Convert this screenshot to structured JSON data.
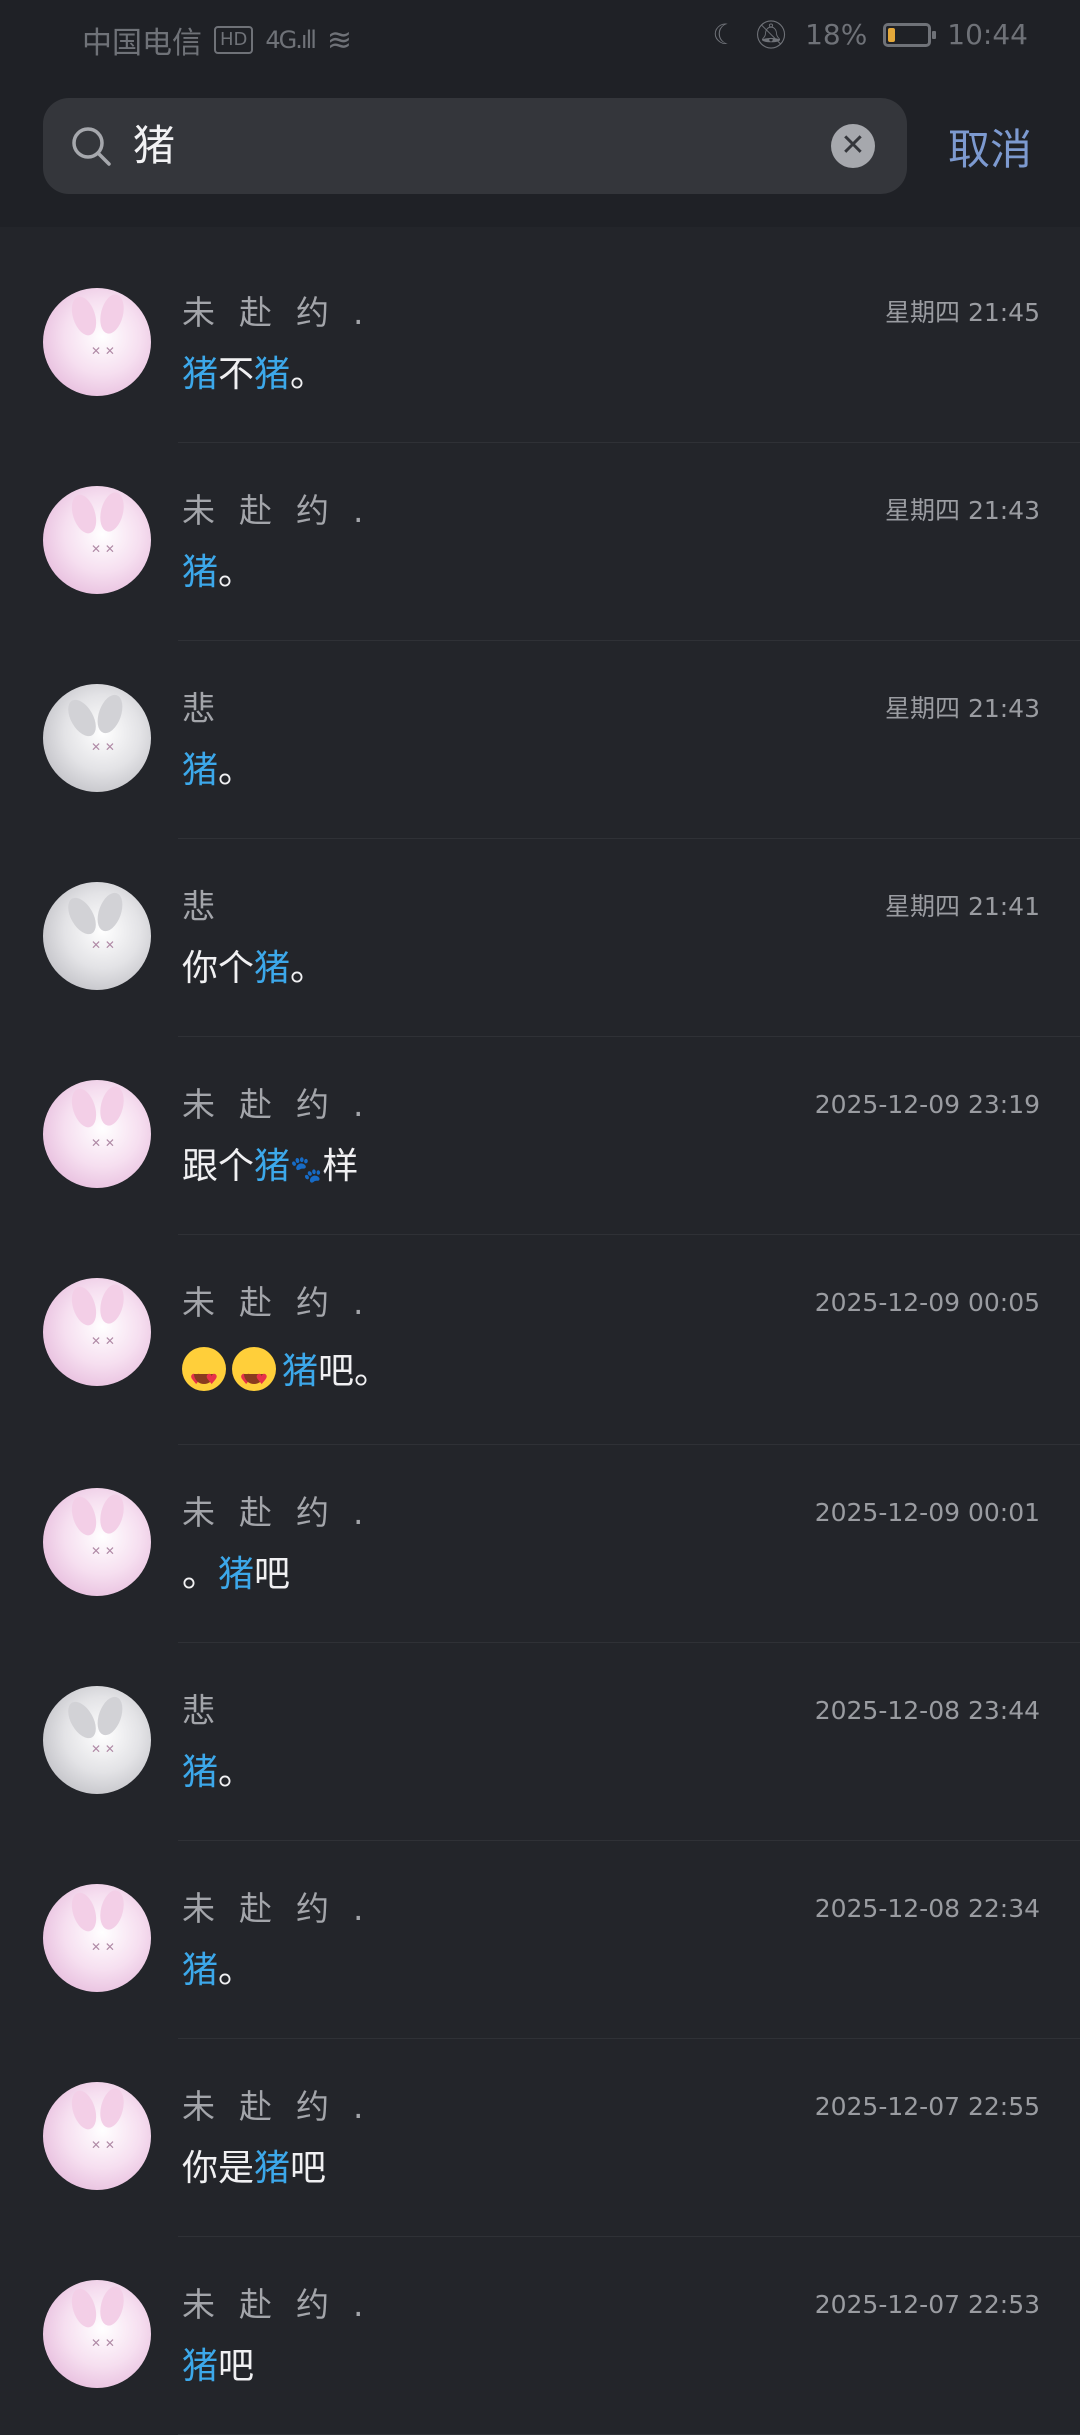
{
  "status_bar": {
    "carrier": "中国电信",
    "network": "4G",
    "hd": "HD",
    "battery": "18%",
    "battery_level": 0.18,
    "time": "10:44"
  },
  "search": {
    "query": "猪",
    "cancel_label": "取消"
  },
  "results": [
    {
      "name": "未赴约.",
      "time": "星期四 21:45",
      "avatar": "pink",
      "segments": [
        {
          "t": "猪",
          "h": true
        },
        {
          "t": "不"
        },
        {
          "t": "猪",
          "h": true
        },
        {
          "t": "。"
        }
      ]
    },
    {
      "name": "未赴约.",
      "time": "星期四 21:43",
      "avatar": "pink",
      "segments": [
        {
          "t": "猪",
          "h": true
        },
        {
          "t": "。"
        }
      ]
    },
    {
      "name": "悲",
      "time": "星期四 21:43",
      "avatar": "gray",
      "segments": [
        {
          "t": "猪",
          "h": true
        },
        {
          "t": "。"
        }
      ]
    },
    {
      "name": "悲",
      "time": "星期四 21:41",
      "avatar": "gray",
      "segments": [
        {
          "t": "你个"
        },
        {
          "t": "猪",
          "h": true
        },
        {
          "t": "。"
        }
      ]
    },
    {
      "name": "未赴约.",
      "time": "2025-12-09 23:19",
      "avatar": "pink",
      "segments": [
        {
          "t": "跟个"
        },
        {
          "t": "猪",
          "h": true
        },
        {
          "t": "🐾",
          "paw": true
        },
        {
          "t": "样"
        }
      ]
    },
    {
      "name": "未赴约.",
      "time": "2025-12-09 00:05",
      "avatar": "pink",
      "tall": true,
      "segments": [
        {
          "emoji": "heart-eyes-emoji"
        },
        {
          "emoji": "heart-eyes-emoji"
        },
        {
          "t": "猪",
          "h": true
        },
        {
          "t": "吧。"
        }
      ]
    },
    {
      "name": "未赴约.",
      "time": "2025-12-09 00:01",
      "avatar": "pink",
      "segments": [
        {
          "t": "。"
        },
        {
          "t": "猪",
          "h": true
        },
        {
          "t": "吧"
        }
      ]
    },
    {
      "name": "悲",
      "time": "2025-12-08 23:44",
      "avatar": "gray",
      "segments": [
        {
          "t": "猪",
          "h": true
        },
        {
          "t": "。"
        }
      ]
    },
    {
      "name": "未赴约.",
      "time": "2025-12-08 22:34",
      "avatar": "pink",
      "segments": [
        {
          "t": "猪",
          "h": true
        },
        {
          "t": "。"
        }
      ]
    },
    {
      "name": "未赴约.",
      "time": "2025-12-07 22:55",
      "avatar": "pink",
      "segments": [
        {
          "t": "你是"
        },
        {
          "t": "猪",
          "h": true
        },
        {
          "t": "吧"
        }
      ]
    },
    {
      "name": "未赴约.",
      "time": "2025-12-07 22:53",
      "avatar": "pink",
      "segments": [
        {
          "t": "猪",
          "h": true
        },
        {
          "t": "吧"
        }
      ]
    }
  ],
  "colors": {
    "background": "#23252a",
    "highlight": "#3ca8ea",
    "cancel": "#7d9ad0"
  }
}
